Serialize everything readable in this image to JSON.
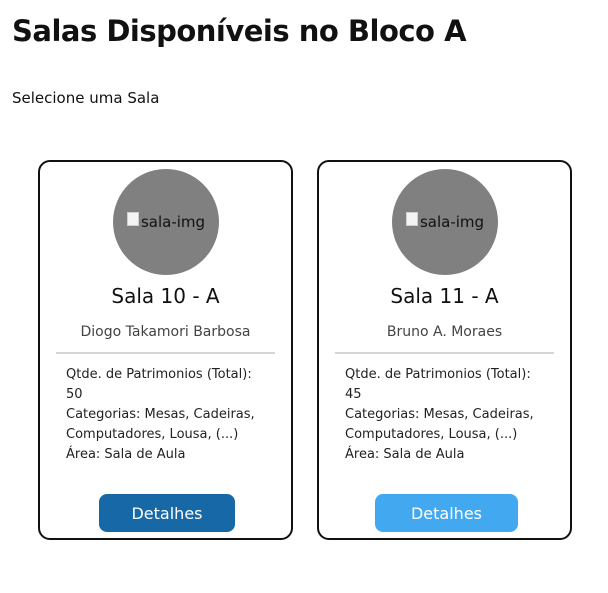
{
  "page": {
    "title": "Salas Disponíveis no Bloco A",
    "subtitle": "Selecione uma Sala"
  },
  "colors": {
    "button_primary": "#1768a6",
    "button_hover": "#42a9f1",
    "avatar_bg": "#808080"
  },
  "rooms": [
    {
      "image_alt": "sala-img",
      "name": "Sala 10 - A",
      "responsible": "Diogo Takamori Barbosa",
      "assets_label": "Qtde. de Patrimonios (Total):",
      "assets_count": "50",
      "categories_line1": "Categorias: Mesas, Cadeiras,",
      "categories_line2": "Computadores, Lousa, (...)",
      "area": "Área: Sala de Aula",
      "button_label": "Detalhes"
    },
    {
      "image_alt": "sala-img",
      "name": "Sala 11 - A",
      "responsible": "Bruno A. Moraes",
      "assets_label": "Qtde. de Patrimonios (Total):",
      "assets_count": "45",
      "categories_line1": "Categorias: Mesas, Cadeiras,",
      "categories_line2": "Computadores, Lousa, (...)",
      "area": "Área: Sala de Aula",
      "button_label": "Detalhes"
    }
  ]
}
